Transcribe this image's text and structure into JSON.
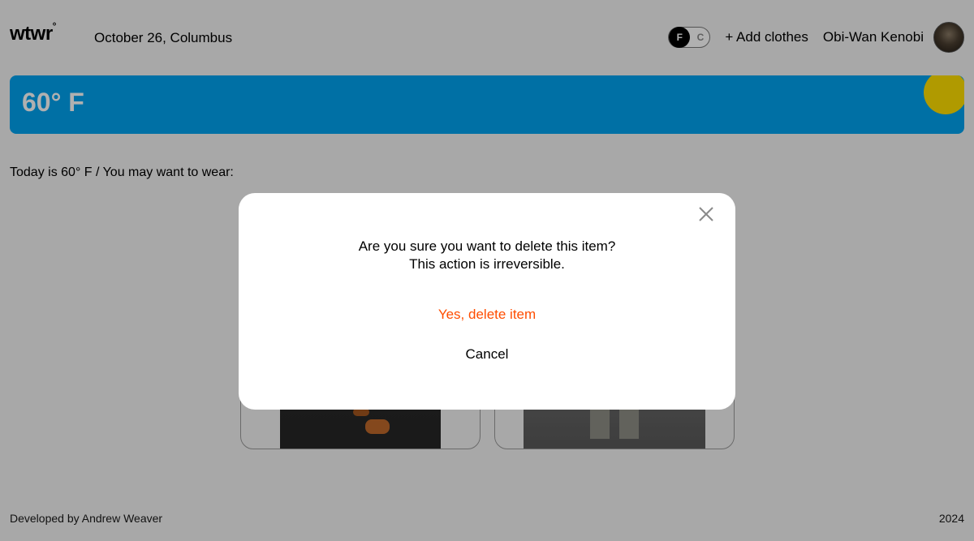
{
  "header": {
    "logo": "wtwr",
    "logo_mark": "°",
    "date_location": "October 26, Columbus",
    "unit_toggle": {
      "active": "F",
      "inactive": "C"
    },
    "add_clothes_label": "+ Add clothes",
    "username": "Obi-Wan Kenobi"
  },
  "weather": {
    "temperature": "60° F",
    "card_color": "#00a2f0",
    "sun_color": "#ffe000"
  },
  "main": {
    "today_text": "Today is 60° F / You may want to wear:"
  },
  "modal": {
    "message_line1": "Are you sure you want to delete this item?",
    "message_line2": "This action is irreversible.",
    "confirm_label": "Yes, delete item",
    "cancel_label": "Cancel",
    "close_icon": "close-icon",
    "confirm_color": "#ff4d00"
  },
  "footer": {
    "credit": "Developed by Andrew Weaver",
    "year": "2024"
  }
}
